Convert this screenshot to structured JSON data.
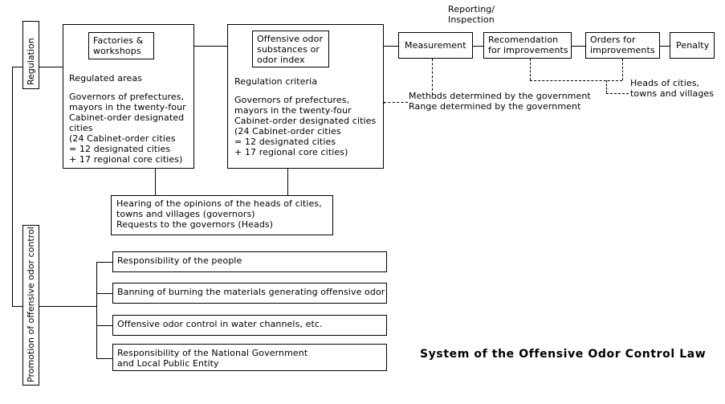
{
  "title": "System of the Offensive Odor Control Law",
  "left_spine": {
    "regulation_label": "Regulation",
    "promotion_label": "Promotion of offensive odor control"
  },
  "regulation_branch": {
    "factories_box": {
      "header": "Factories &\nworkshops",
      "section_label": "Regulated areas",
      "body": "Governors of prefectures,\nmayors in the twenty-four\nCabinet-order designated\ncities\n(24 Cabinet-order cities\n = 12 designated cities\n + 17 regional core cities)"
    },
    "substances_box": {
      "header": "Offensive odor\nsubstances or\nodor index",
      "section_label": "Regulation criteria",
      "body": "Governors of prefectures,\nmayors in the twenty-four\nCabinet-order designated cities\n(24 Cabinet-order cities\n = 12 designated cities\n + 17 regional core cities)"
    },
    "hearing_box": "Hearing of the opinions of the heads of cities,\ntowns and villages (governors)\nRequests to the governors (Heads)"
  },
  "enforcement_chain": {
    "reporting_label": "Reporting/\nInspection",
    "steps": [
      {
        "label": "Measurement"
      },
      {
        "label": "Recomendation\nfor improvements"
      },
      {
        "label": "Orders for\nimprovements"
      },
      {
        "label": "Penalty"
      }
    ],
    "annotations": {
      "methods": "Methods determined by the government",
      "range": "Range determined by the government",
      "heads": "Heads of cities,\ntowns and villages"
    }
  },
  "promotion_branch": {
    "items": [
      {
        "label": "Responsibility of the people"
      },
      {
        "label": "Banning of burning the materials generating offensive odor"
      },
      {
        "label": "Offensive odor control in water channels, etc."
      },
      {
        "label": "Responsibility of the National Government\nand Local Public Entity"
      }
    ]
  },
  "colors": {
    "ink": "#000000",
    "paper": "#ffffff"
  }
}
